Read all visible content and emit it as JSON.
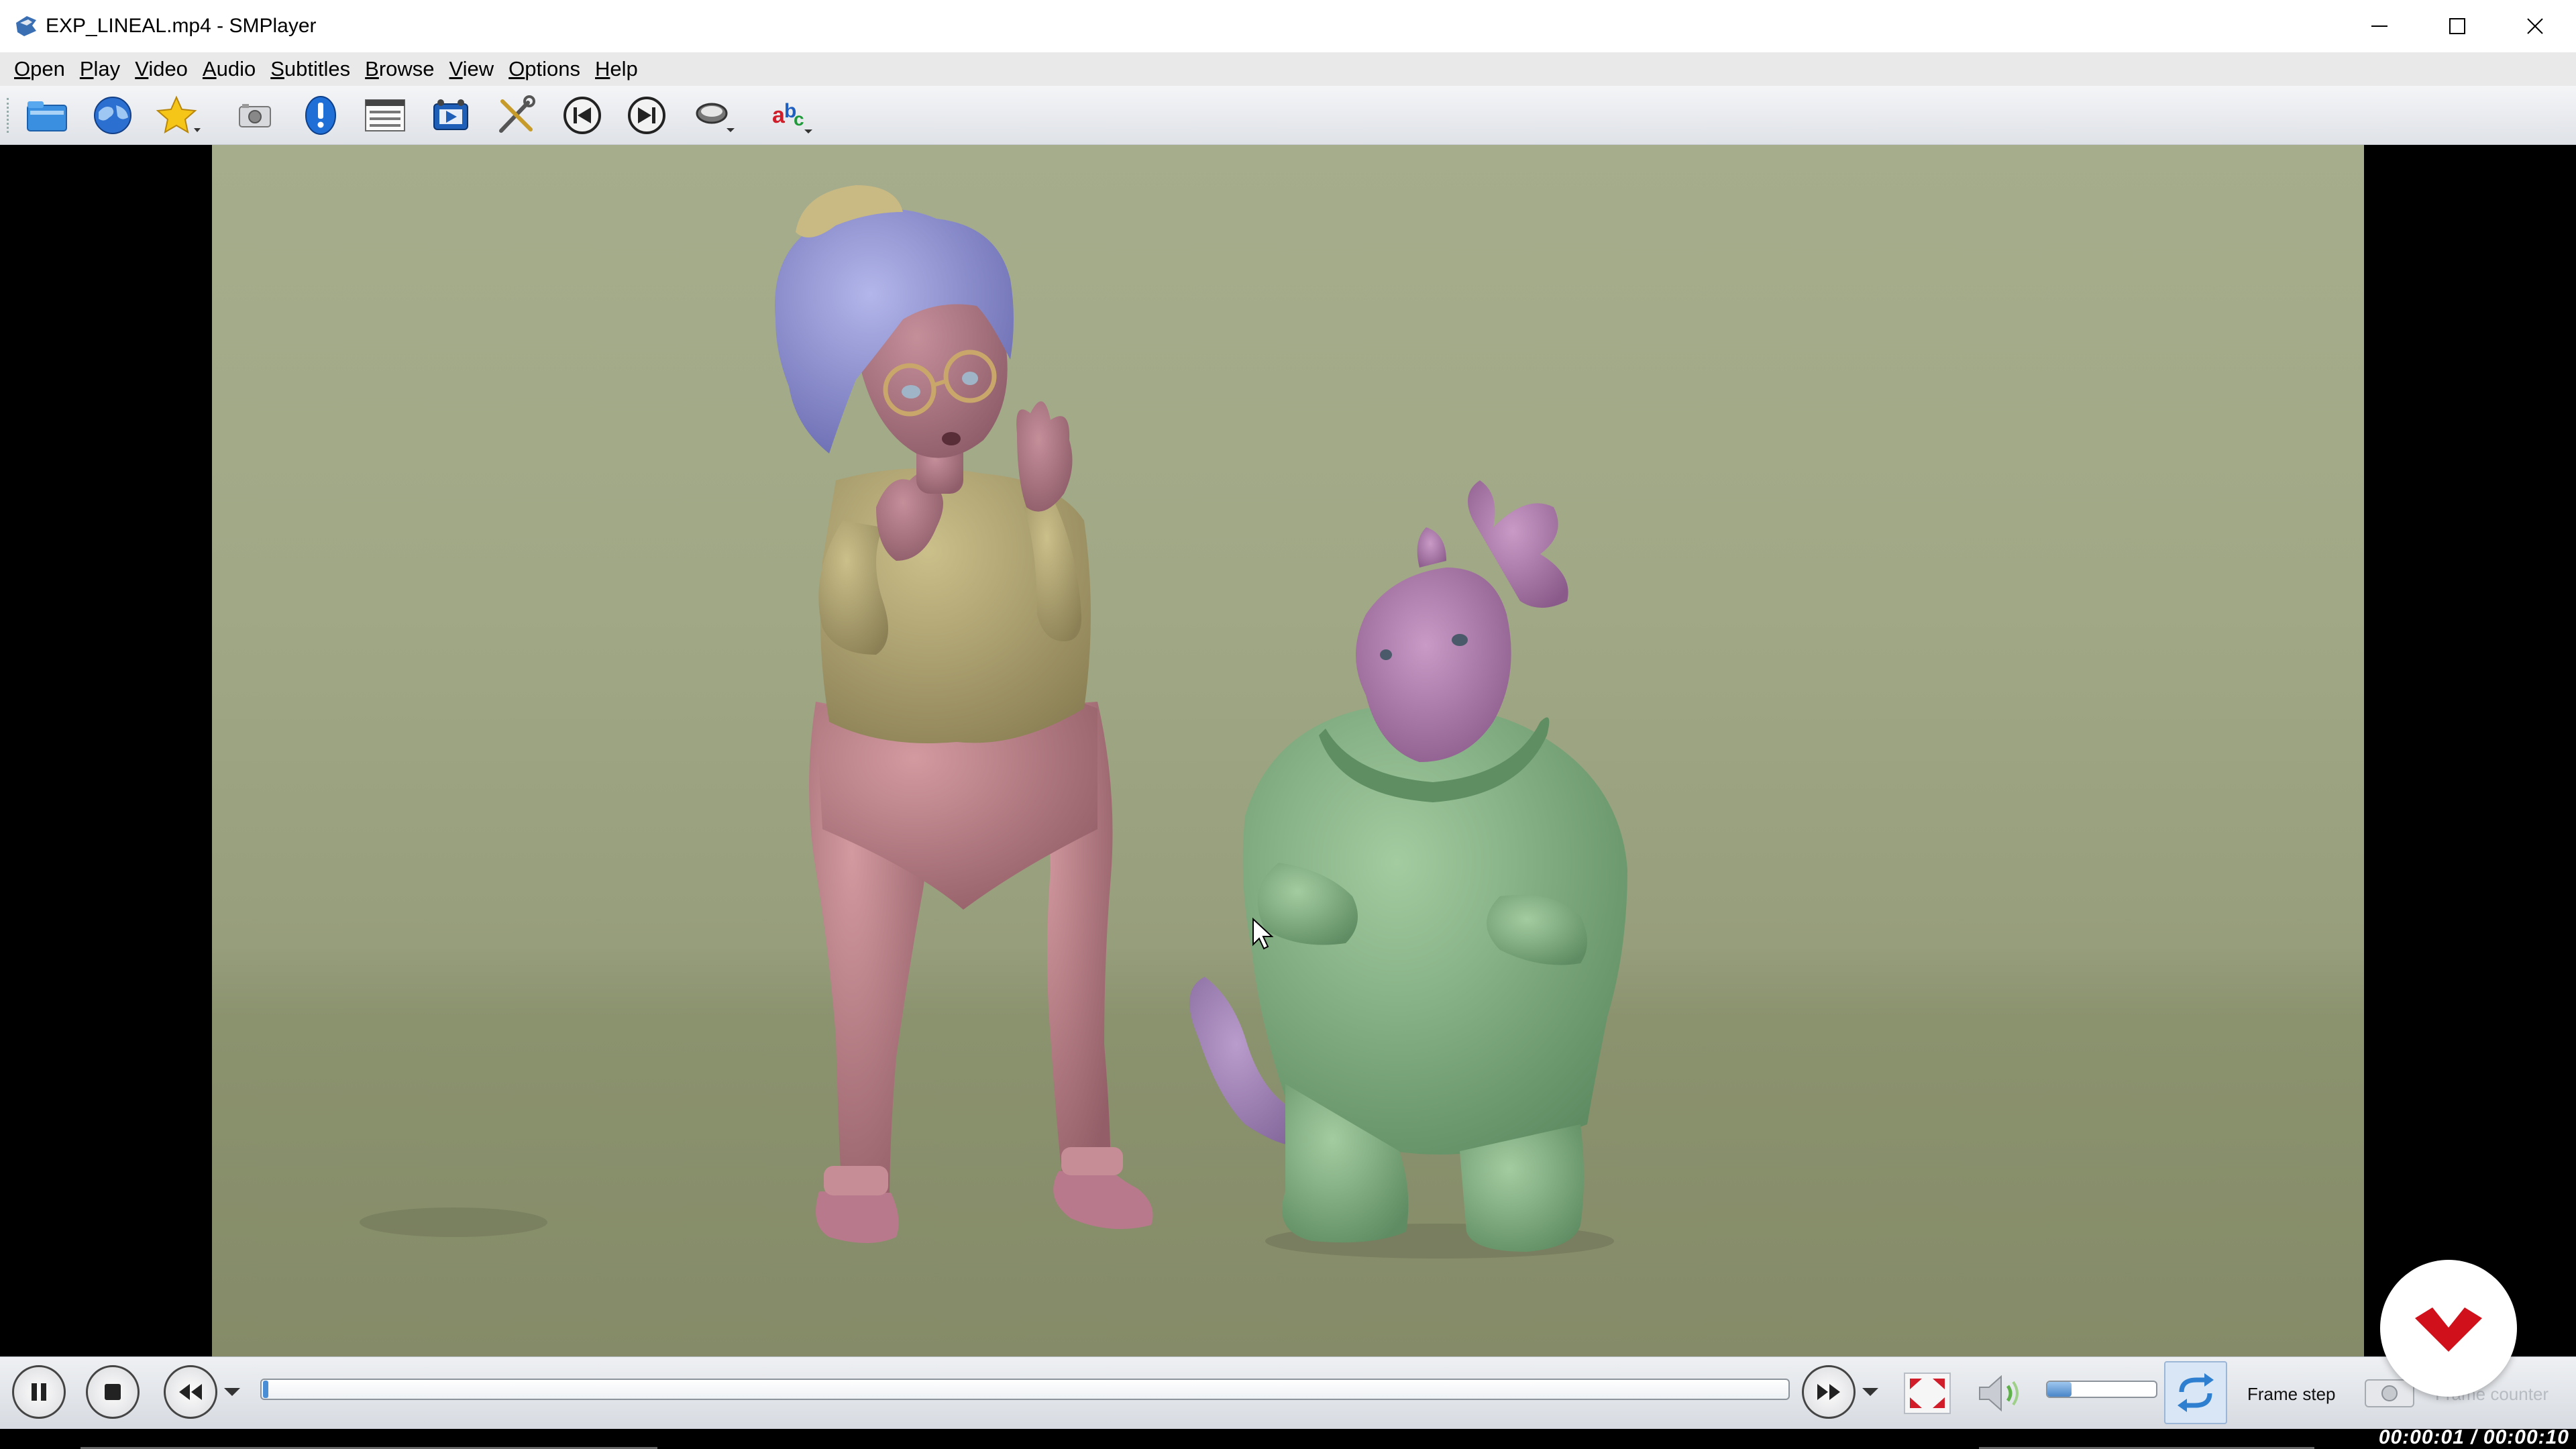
{
  "window": {
    "title": "EXP_LINEAL.mp4 - SMPlayer",
    "app_icon": "smplayer-icon",
    "controls": [
      "minimize-icon",
      "maximize-icon",
      "close-icon"
    ]
  },
  "menu": [
    {
      "label": "Open"
    },
    {
      "label": "Play"
    },
    {
      "label": "Video"
    },
    {
      "label": "Audio"
    },
    {
      "label": "Subtitles"
    },
    {
      "label": "Browse"
    },
    {
      "label": "View"
    },
    {
      "label": "Options"
    },
    {
      "label": "Help"
    }
  ],
  "toolbar": [
    {
      "name": "open-folder-icon"
    },
    {
      "name": "open-url-globe-icon"
    },
    {
      "name": "favorites-star-icon",
      "dropdown": true
    },
    {
      "name": "screenshot-camera-icon"
    },
    {
      "name": "info-icon"
    },
    {
      "name": "playlist-icon"
    },
    {
      "name": "video-filter-icon"
    },
    {
      "name": "preferences-tools-icon"
    },
    {
      "name": "previous-icon"
    },
    {
      "name": "next-icon"
    },
    {
      "name": "audio-track-icon",
      "dropdown": true
    },
    {
      "name": "subtitle-track-icon",
      "dropdown": true
    }
  ],
  "controls": {
    "play_pause": "pause-icon",
    "stop": "stop-icon",
    "rewind": "rewind-icon",
    "forward": "forward-icon",
    "fullscreen": "fullscreen-icon",
    "mute": "speaker-icon",
    "repeat": "repeat-icon",
    "frame_step_label": "Frame step",
    "frame_counter_label": "Frame counter",
    "seek_progress": 0.0,
    "volume_level": 0.22
  },
  "status": {
    "time": "00:00:01 / 00:00:10"
  },
  "colors": {
    "accent": "#3c88d8",
    "overlay_logo": "#d0111b"
  }
}
